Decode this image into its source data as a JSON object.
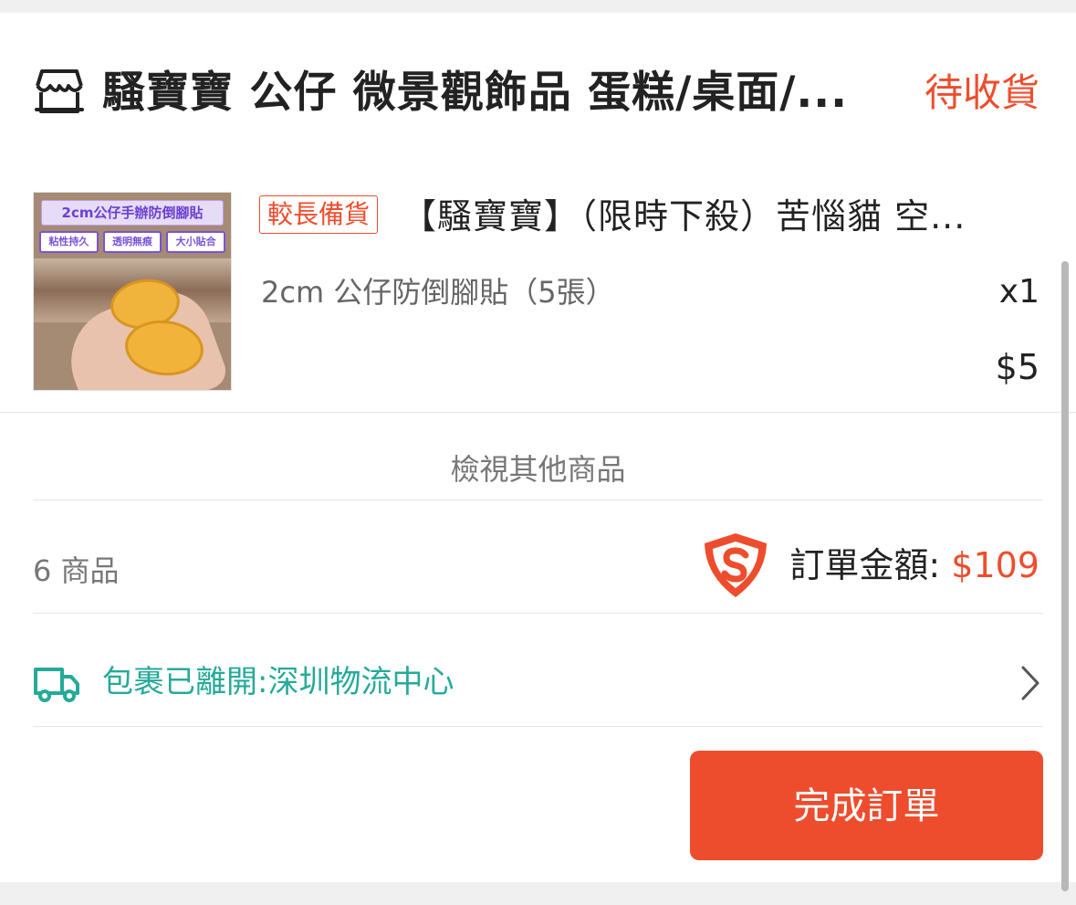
{
  "shop": {
    "name": "騷寶寶 公仔 微景觀飾品 蛋糕/桌面/...",
    "status": "待收貨"
  },
  "product": {
    "thumbnail": {
      "title": "2cm公仔手辦防倒腳貼",
      "tags": [
        "粘性持久",
        "透明無痕",
        "大小貼合"
      ]
    },
    "badge": "較長備貨",
    "title": "【騷寶寶】（限時下殺）苦惱貓 空...",
    "variation": "2cm 公仔防倒腳貼（5張）",
    "quantity": "x1",
    "price": "$5"
  },
  "view_others": "檢視其他商品",
  "summary": {
    "item_count": "6 商品",
    "total_label": "訂單金額: ",
    "total_value": "$109"
  },
  "shipping": {
    "status": "包裹已離開:深圳物流中心"
  },
  "actions": {
    "complete_label": "完成訂單"
  },
  "colors": {
    "accent": "#ee4d2d",
    "shipping": "#26aa99"
  },
  "icons": {
    "shop": "shop-icon",
    "shield": "shopee-guarantee-shield-icon",
    "truck": "truck-icon",
    "chevron": "chevron-right-icon"
  }
}
